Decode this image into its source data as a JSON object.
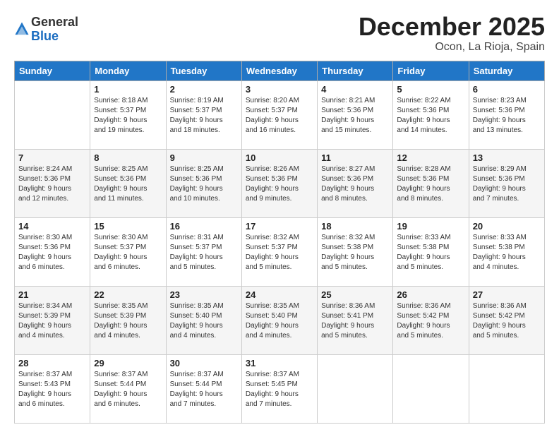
{
  "header": {
    "logo_general": "General",
    "logo_blue": "Blue",
    "month_title": "December 2025",
    "location": "Ocon, La Rioja, Spain"
  },
  "weekdays": [
    "Sunday",
    "Monday",
    "Tuesday",
    "Wednesday",
    "Thursday",
    "Friday",
    "Saturday"
  ],
  "weeks": [
    [
      {
        "day": "",
        "sunrise": "",
        "sunset": "",
        "daylight": ""
      },
      {
        "day": "1",
        "sunrise": "Sunrise: 8:18 AM",
        "sunset": "Sunset: 5:37 PM",
        "daylight": "Daylight: 9 hours and 19 minutes."
      },
      {
        "day": "2",
        "sunrise": "Sunrise: 8:19 AM",
        "sunset": "Sunset: 5:37 PM",
        "daylight": "Daylight: 9 hours and 18 minutes."
      },
      {
        "day": "3",
        "sunrise": "Sunrise: 8:20 AM",
        "sunset": "Sunset: 5:37 PM",
        "daylight": "Daylight: 9 hours and 16 minutes."
      },
      {
        "day": "4",
        "sunrise": "Sunrise: 8:21 AM",
        "sunset": "Sunset: 5:36 PM",
        "daylight": "Daylight: 9 hours and 15 minutes."
      },
      {
        "day": "5",
        "sunrise": "Sunrise: 8:22 AM",
        "sunset": "Sunset: 5:36 PM",
        "daylight": "Daylight: 9 hours and 14 minutes."
      },
      {
        "day": "6",
        "sunrise": "Sunrise: 8:23 AM",
        "sunset": "Sunset: 5:36 PM",
        "daylight": "Daylight: 9 hours and 13 minutes."
      }
    ],
    [
      {
        "day": "7",
        "sunrise": "Sunrise: 8:24 AM",
        "sunset": "Sunset: 5:36 PM",
        "daylight": "Daylight: 9 hours and 12 minutes."
      },
      {
        "day": "8",
        "sunrise": "Sunrise: 8:25 AM",
        "sunset": "Sunset: 5:36 PM",
        "daylight": "Daylight: 9 hours and 11 minutes."
      },
      {
        "day": "9",
        "sunrise": "Sunrise: 8:25 AM",
        "sunset": "Sunset: 5:36 PM",
        "daylight": "Daylight: 9 hours and 10 minutes."
      },
      {
        "day": "10",
        "sunrise": "Sunrise: 8:26 AM",
        "sunset": "Sunset: 5:36 PM",
        "daylight": "Daylight: 9 hours and 9 minutes."
      },
      {
        "day": "11",
        "sunrise": "Sunrise: 8:27 AM",
        "sunset": "Sunset: 5:36 PM",
        "daylight": "Daylight: 9 hours and 8 minutes."
      },
      {
        "day": "12",
        "sunrise": "Sunrise: 8:28 AM",
        "sunset": "Sunset: 5:36 PM",
        "daylight": "Daylight: 9 hours and 8 minutes."
      },
      {
        "day": "13",
        "sunrise": "Sunrise: 8:29 AM",
        "sunset": "Sunset: 5:36 PM",
        "daylight": "Daylight: 9 hours and 7 minutes."
      }
    ],
    [
      {
        "day": "14",
        "sunrise": "Sunrise: 8:30 AM",
        "sunset": "Sunset: 5:36 PM",
        "daylight": "Daylight: 9 hours and 6 minutes."
      },
      {
        "day": "15",
        "sunrise": "Sunrise: 8:30 AM",
        "sunset": "Sunset: 5:37 PM",
        "daylight": "Daylight: 9 hours and 6 minutes."
      },
      {
        "day": "16",
        "sunrise": "Sunrise: 8:31 AM",
        "sunset": "Sunset: 5:37 PM",
        "daylight": "Daylight: 9 hours and 5 minutes."
      },
      {
        "day": "17",
        "sunrise": "Sunrise: 8:32 AM",
        "sunset": "Sunset: 5:37 PM",
        "daylight": "Daylight: 9 hours and 5 minutes."
      },
      {
        "day": "18",
        "sunrise": "Sunrise: 8:32 AM",
        "sunset": "Sunset: 5:38 PM",
        "daylight": "Daylight: 9 hours and 5 minutes."
      },
      {
        "day": "19",
        "sunrise": "Sunrise: 8:33 AM",
        "sunset": "Sunset: 5:38 PM",
        "daylight": "Daylight: 9 hours and 5 minutes."
      },
      {
        "day": "20",
        "sunrise": "Sunrise: 8:33 AM",
        "sunset": "Sunset: 5:38 PM",
        "daylight": "Daylight: 9 hours and 4 minutes."
      }
    ],
    [
      {
        "day": "21",
        "sunrise": "Sunrise: 8:34 AM",
        "sunset": "Sunset: 5:39 PM",
        "daylight": "Daylight: 9 hours and 4 minutes."
      },
      {
        "day": "22",
        "sunrise": "Sunrise: 8:35 AM",
        "sunset": "Sunset: 5:39 PM",
        "daylight": "Daylight: 9 hours and 4 minutes."
      },
      {
        "day": "23",
        "sunrise": "Sunrise: 8:35 AM",
        "sunset": "Sunset: 5:40 PM",
        "daylight": "Daylight: 9 hours and 4 minutes."
      },
      {
        "day": "24",
        "sunrise": "Sunrise: 8:35 AM",
        "sunset": "Sunset: 5:40 PM",
        "daylight": "Daylight: 9 hours and 4 minutes."
      },
      {
        "day": "25",
        "sunrise": "Sunrise: 8:36 AM",
        "sunset": "Sunset: 5:41 PM",
        "daylight": "Daylight: 9 hours and 5 minutes."
      },
      {
        "day": "26",
        "sunrise": "Sunrise: 8:36 AM",
        "sunset": "Sunset: 5:42 PM",
        "daylight": "Daylight: 9 hours and 5 minutes."
      },
      {
        "day": "27",
        "sunrise": "Sunrise: 8:36 AM",
        "sunset": "Sunset: 5:42 PM",
        "daylight": "Daylight: 9 hours and 5 minutes."
      }
    ],
    [
      {
        "day": "28",
        "sunrise": "Sunrise: 8:37 AM",
        "sunset": "Sunset: 5:43 PM",
        "daylight": "Daylight: 9 hours and 6 minutes."
      },
      {
        "day": "29",
        "sunrise": "Sunrise: 8:37 AM",
        "sunset": "Sunset: 5:44 PM",
        "daylight": "Daylight: 9 hours and 6 minutes."
      },
      {
        "day": "30",
        "sunrise": "Sunrise: 8:37 AM",
        "sunset": "Sunset: 5:44 PM",
        "daylight": "Daylight: 9 hours and 7 minutes."
      },
      {
        "day": "31",
        "sunrise": "Sunrise: 8:37 AM",
        "sunset": "Sunset: 5:45 PM",
        "daylight": "Daylight: 9 hours and 7 minutes."
      },
      {
        "day": "",
        "sunrise": "",
        "sunset": "",
        "daylight": ""
      },
      {
        "day": "",
        "sunrise": "",
        "sunset": "",
        "daylight": ""
      },
      {
        "day": "",
        "sunrise": "",
        "sunset": "",
        "daylight": ""
      }
    ]
  ]
}
